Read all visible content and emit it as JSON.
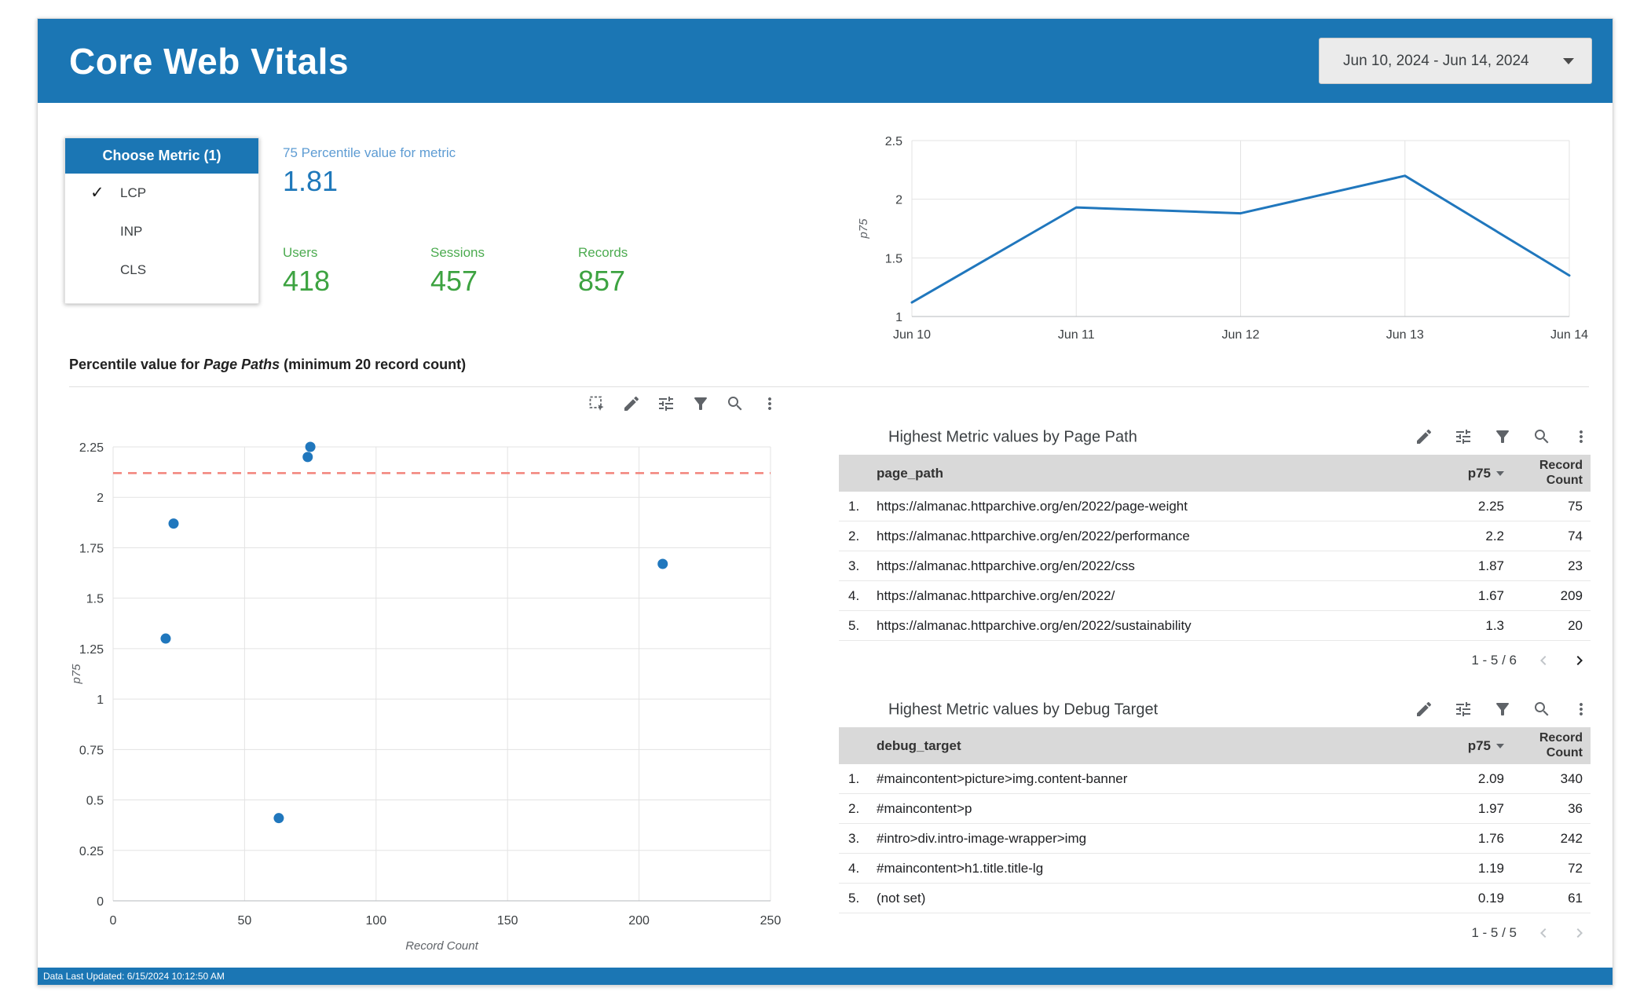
{
  "header": {
    "title": "Core Web Vitals",
    "date_range": "Jun 10, 2024 - Jun 14, 2024"
  },
  "metric_selector": {
    "title": "Choose Metric (1)",
    "options": [
      {
        "label": "LCP",
        "selected": true
      },
      {
        "label": "INP",
        "selected": false
      },
      {
        "label": "CLS",
        "selected": false
      }
    ]
  },
  "scorecards": {
    "percentile": {
      "label": "75 Percentile value for metric",
      "value": "1.81"
    },
    "users": {
      "label": "Users",
      "value": "418"
    },
    "sessions": {
      "label": "Sessions",
      "value": "457"
    },
    "records": {
      "label": "Records",
      "value": "857"
    }
  },
  "section": {
    "title_prefix": "Percentile value for ",
    "title_italic": "Page Paths",
    "title_suffix": " (minimum 20 record count)"
  },
  "tables": [
    {
      "title": "Highest Metric values by Page Path",
      "columns": [
        "page_path",
        "p75",
        "Record Count"
      ],
      "rows": [
        [
          "https://almanac.httparchive.org/en/2022/page-weight",
          "2.25",
          "75"
        ],
        [
          "https://almanac.httparchive.org/en/2022/performance",
          "2.2",
          "74"
        ],
        [
          "https://almanac.httparchive.org/en/2022/css",
          "1.87",
          "23"
        ],
        [
          "https://almanac.httparchive.org/en/2022/",
          "1.67",
          "209"
        ],
        [
          "https://almanac.httparchive.org/en/2022/sustainability",
          "1.3",
          "20"
        ]
      ],
      "pagination": "1 - 5 / 6",
      "prev_enabled": false,
      "next_enabled": true
    },
    {
      "title": "Highest Metric values by Debug Target",
      "columns": [
        "debug_target",
        "p75",
        "Record Count"
      ],
      "rows": [
        [
          "#maincontent>picture>img.content-banner",
          "2.09",
          "340"
        ],
        [
          "#maincontent>p",
          "1.97",
          "36"
        ],
        [
          "#intro>div.intro-image-wrapper>img",
          "1.76",
          "242"
        ],
        [
          "#maincontent>h1.title.title-lg",
          "1.19",
          "72"
        ],
        [
          "(not set)",
          "0.19",
          "61"
        ]
      ],
      "pagination": "1 - 5 / 5",
      "prev_enabled": false,
      "next_enabled": false
    }
  ],
  "footer": {
    "text": "Data Last Updated: 6/15/2024 10:12:50 AM"
  },
  "colors": {
    "primary_blue": "#1b76b4",
    "series": "#2077bd",
    "score_label_blue": "#5e9cd3",
    "score_value_blue": "#1e78ba",
    "green": "#3da341",
    "ref_line": "#f2837b",
    "table_header_bg": "#d9d9d9"
  },
  "chart_data": [
    {
      "type": "line",
      "title": "p75 over time",
      "x": [
        "Jun 10",
        "Jun 11",
        "Jun 12",
        "Jun 13",
        "Jun 14"
      ],
      "values": [
        1.12,
        1.93,
        1.88,
        2.2,
        1.35
      ],
      "xlabel": "",
      "ylabel": "p75",
      "ylim": [
        1,
        2.5
      ],
      "yticks": [
        1,
        1.5,
        2,
        2.5
      ],
      "grid": true,
      "legend": false
    },
    {
      "type": "scatter",
      "title": "Percentile value for Page Paths (minimum 20 record count)",
      "points": [
        [
          75,
          2.25
        ],
        [
          74,
          2.2
        ],
        [
          23,
          1.87
        ],
        [
          209,
          1.67
        ],
        [
          20,
          1.3
        ],
        [
          63,
          0.41
        ]
      ],
      "xlabel": "Record Count",
      "ylabel": "p75",
      "xlim": [
        0,
        250
      ],
      "ylim": [
        0,
        2.25
      ],
      "xticks": [
        0,
        50,
        100,
        150,
        200,
        250
      ],
      "yticks": [
        0,
        0.25,
        0.5,
        0.75,
        1,
        1.25,
        1.5,
        1.75,
        2,
        2.25
      ],
      "ref_line_y": 2.12,
      "grid": true,
      "legend": false
    }
  ]
}
